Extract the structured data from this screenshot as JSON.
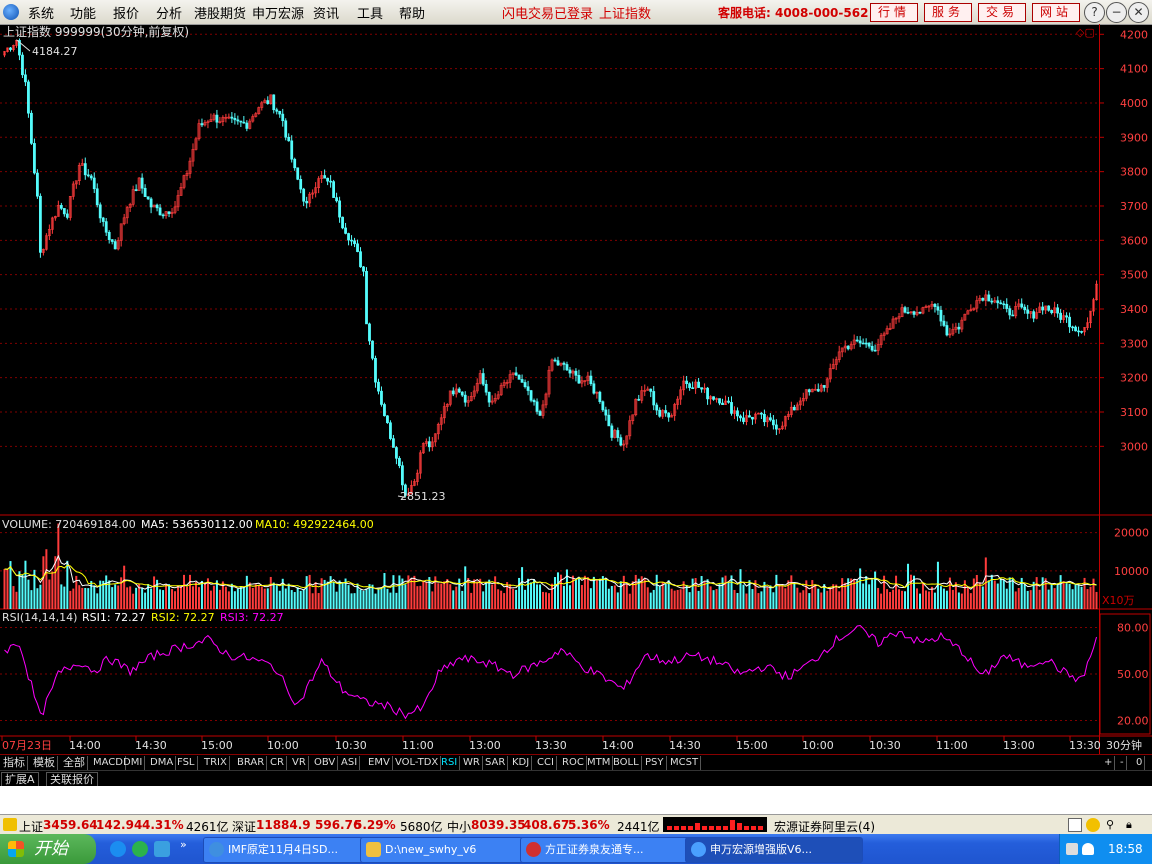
{
  "menubar": {
    "items": [
      "系统",
      "功能",
      "报价",
      "分析",
      "港股期货",
      "申万宏源",
      "资讯",
      "工具",
      "帮助"
    ],
    "notice1": "闪电交易已登录",
    "notice2": "上证指数",
    "hotline": "客服电话: 4008-000-562",
    "buttons": [
      "行情",
      "服务",
      "交易",
      "网站"
    ],
    "winbtns": [
      "?",
      "−",
      "❐",
      "✕"
    ]
  },
  "chart": {
    "header": "上证指数 999999(30分钟,前复权)",
    "high_label": "4184.27",
    "low_label": "2851.23",
    "price_ticks": [
      "4200",
      "4100",
      "4000",
      "3900",
      "3800",
      "3700",
      "3600",
      "3500",
      "3400",
      "3300",
      "3200",
      "3100",
      "3000"
    ],
    "volume_header": {
      "label": "VOLUME: 720469184.00",
      "ma5": "MA5: 536530112.00",
      "ma10": "MA10: 492922464.00"
    },
    "volume_ticks": [
      "20000",
      "10000"
    ],
    "volume_unit": "X10万",
    "rsi_header": {
      "label": "RSI(14,14,14)",
      "rsi1": "RSI1: 72.27",
      "rsi2": "RSI2: 72.27",
      "rsi3": "RSI3: 72.27"
    },
    "rsi_ticks": [
      "80.00",
      "50.00",
      "20.00"
    ],
    "time_labels": [
      "07月23日",
      "14:00",
      "14:30",
      "15:00",
      "10:00",
      "10:30",
      "11:00",
      "13:00",
      "13:30",
      "14:00",
      "14:30",
      "15:00",
      "10:00",
      "10:30",
      "11:00",
      "13:00",
      "13:30"
    ],
    "period": "30分钟",
    "colors": {
      "up": "#ff3c3c",
      "down": "#54fcfc",
      "ma5": "#ffffff",
      "ma10": "#ffff00",
      "rsi": "#ff00ff",
      "grid": "#800000",
      "axis": "#c00000"
    }
  },
  "chart_data": {
    "type": "candlestick",
    "title": "上证指数 999999(30分钟,前复权)",
    "ylim": [
      2800,
      4230
    ],
    "high": 4184.27,
    "low": 2851.23,
    "close_anchors": [
      [
        0,
        4150
      ],
      [
        4,
        4184
      ],
      [
        7,
        4050
      ],
      [
        11,
        3720
      ],
      [
        12,
        3560
      ],
      [
        15,
        3640
      ],
      [
        18,
        3700
      ],
      [
        21,
        3680
      ],
      [
        25,
        3820
      ],
      [
        29,
        3780
      ],
      [
        33,
        3640
      ],
      [
        37,
        3580
      ],
      [
        41,
        3700
      ],
      [
        45,
        3770
      ],
      [
        49,
        3700
      ],
      [
        53,
        3680
      ],
      [
        57,
        3700
      ],
      [
        61,
        3800
      ],
      [
        65,
        3930
      ],
      [
        69,
        3960
      ],
      [
        73,
        3950
      ],
      [
        77,
        3940
      ],
      [
        81,
        3940
      ],
      [
        85,
        3990
      ],
      [
        89,
        4010
      ],
      [
        93,
        3950
      ],
      [
        97,
        3800
      ],
      [
        101,
        3700
      ],
      [
        105,
        3790
      ],
      [
        109,
        3760
      ],
      [
        113,
        3650
      ],
      [
        117,
        3580
      ],
      [
        120,
        3510
      ],
      [
        121,
        3370
      ],
      [
        124,
        3200
      ],
      [
        128,
        3060
      ],
      [
        131,
        2980
      ],
      [
        134,
        2860
      ],
      [
        137,
        2900
      ],
      [
        140,
        3010
      ],
      [
        143,
        3000
      ],
      [
        147,
        3120
      ],
      [
        151,
        3180
      ],
      [
        155,
        3130
      ],
      [
        159,
        3200
      ],
      [
        163,
        3120
      ],
      [
        167,
        3180
      ],
      [
        171,
        3210
      ],
      [
        175,
        3150
      ],
      [
        179,
        3080
      ],
      [
        183,
        3250
      ],
      [
        187,
        3230
      ],
      [
        191,
        3200
      ],
      [
        195,
        3190
      ],
      [
        199,
        3140
      ],
      [
        203,
        3040
      ],
      [
        207,
        3010
      ],
      [
        211,
        3130
      ],
      [
        215,
        3170
      ],
      [
        219,
        3090
      ],
      [
        223,
        3100
      ],
      [
        227,
        3190
      ],
      [
        231,
        3180
      ],
      [
        235,
        3150
      ],
      [
        239,
        3140
      ],
      [
        243,
        3110
      ],
      [
        247,
        3080
      ],
      [
        251,
        3090
      ],
      [
        255,
        3070
      ],
      [
        259,
        3060
      ],
      [
        263,
        3100
      ],
      [
        267,
        3150
      ],
      [
        271,
        3160
      ],
      [
        275,
        3190
      ],
      [
        279,
        3280
      ],
      [
        283,
        3300
      ],
      [
        287,
        3300
      ],
      [
        291,
        3290
      ],
      [
        295,
        3330
      ],
      [
        299,
        3390
      ],
      [
        303,
        3400
      ],
      [
        307,
        3390
      ],
      [
        311,
        3420
      ],
      [
        315,
        3330
      ],
      [
        319,
        3350
      ],
      [
        323,
        3410
      ],
      [
        327,
        3440
      ],
      [
        331,
        3430
      ],
      [
        335,
        3390
      ],
      [
        339,
        3400
      ],
      [
        343,
        3380
      ],
      [
        347,
        3410
      ],
      [
        351,
        3390
      ],
      [
        355,
        3370
      ],
      [
        359,
        3340
      ],
      [
        362,
        3360
      ],
      [
        365,
        3459
      ]
    ],
    "volume": {
      "ylim": [
        0,
        22000
      ],
      "unit": "X10万",
      "ma5": 536530112,
      "ma10": 492922464,
      "last": 720469184
    },
    "rsi": {
      "ylim": [
        10,
        90
      ],
      "last": 72.27,
      "anchors": [
        [
          0,
          65
        ],
        [
          5,
          70
        ],
        [
          12,
          22
        ],
        [
          18,
          50
        ],
        [
          25,
          58
        ],
        [
          30,
          52
        ],
        [
          35,
          60
        ],
        [
          42,
          52
        ],
        [
          50,
          62
        ],
        [
          60,
          68
        ],
        [
          68,
          72
        ],
        [
          75,
          62
        ],
        [
          82,
          60
        ],
        [
          90,
          55
        ],
        [
          98,
          30
        ],
        [
          106,
          58
        ],
        [
          113,
          40
        ],
        [
          120,
          32
        ],
        [
          127,
          30
        ],
        [
          134,
          24
        ],
        [
          140,
          28
        ],
        [
          145,
          50
        ],
        [
          152,
          60
        ],
        [
          160,
          58
        ],
        [
          170,
          50
        ],
        [
          180,
          58
        ],
        [
          186,
          66
        ],
        [
          193,
          55
        ],
        [
          200,
          48
        ],
        [
          207,
          40
        ],
        [
          214,
          62
        ],
        [
          222,
          58
        ],
        [
          230,
          62
        ],
        [
          238,
          58
        ],
        [
          246,
          50
        ],
        [
          254,
          55
        ],
        [
          262,
          48
        ],
        [
          270,
          58
        ],
        [
          278,
          72
        ],
        [
          285,
          80
        ],
        [
          292,
          70
        ],
        [
          299,
          78
        ],
        [
          306,
          70
        ],
        [
          313,
          74
        ],
        [
          320,
          65
        ],
        [
          327,
          48
        ],
        [
          334,
          62
        ],
        [
          341,
          55
        ],
        [
          348,
          60
        ],
        [
          355,
          50
        ],
        [
          360,
          46
        ],
        [
          365,
          72
        ]
      ]
    }
  },
  "tabbar": {
    "tabs": [
      "指标",
      "模板",
      "全部",
      "MACD",
      "DMI",
      "DMA",
      "FSL",
      "TRIX",
      "BRAR",
      "CR",
      "VR",
      "OBV",
      "ASI",
      "EMV",
      "VOL-TDX",
      "RSI",
      "WR",
      "SAR",
      "KDJ",
      "CCI",
      "ROC",
      "MTM",
      "BOLL",
      "PSY",
      "MCST"
    ],
    "active": "RSI",
    "right": [
      "+",
      "-",
      "0"
    ]
  },
  "tabbar2": {
    "tabs": [
      "扩展A",
      "关联报价"
    ]
  },
  "statusbar": {
    "sh_label": "上证",
    "sh_value": "3459.64",
    "sh_change": "142.94",
    "sh_pct": "4.31%",
    "sh_amount": "4261亿",
    "sz_label": "深证",
    "sz_value": "11884.9",
    "sz_change": "596.76",
    "sz_pct": "5.29%",
    "sz_amount": "5680亿",
    "zx_label": "中小",
    "zx_value": "8039.35",
    "zx_change": "408.67",
    "zx_pct": "5.36%",
    "zx_amount": "2441亿",
    "broker": "宏源证券阿里云(4)"
  },
  "taskbar": {
    "start": "开始",
    "tasks": [
      "IMF原定11月4日SD...",
      "D:\\new_swhy_v6",
      "方正证券泉友通专...",
      "申万宏源增强版V6..."
    ],
    "clock": "18:58"
  }
}
